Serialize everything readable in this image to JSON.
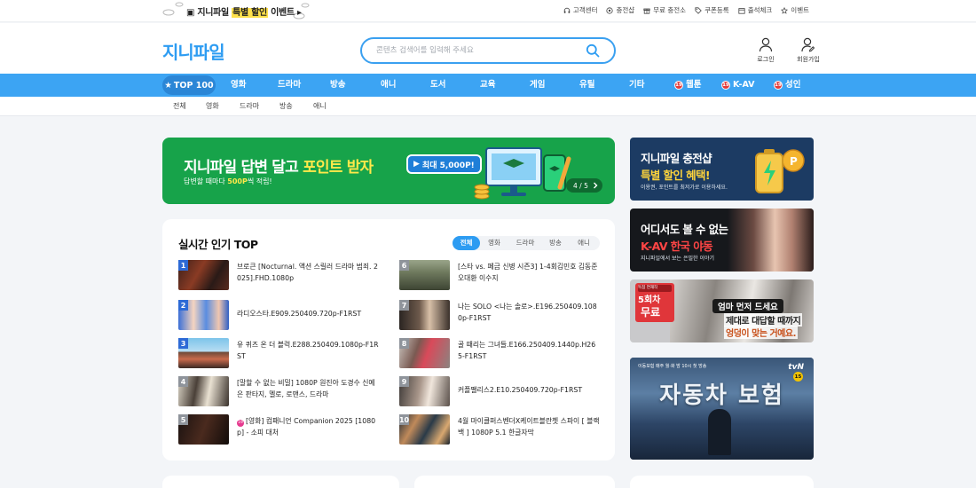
{
  "promo": {
    "before": "지니파일 ",
    "highlight": "특별 할인",
    "after": " 이벤트",
    "arrow": "▸"
  },
  "util_links": [
    {
      "label": "고객센터",
      "icon": "headset-icon"
    },
    {
      "label": "충전샵",
      "icon": "coin-icon"
    },
    {
      "label": "무료 충전소",
      "icon": "gift-icon"
    },
    {
      "label": "쿠폰등록",
      "icon": "tag-icon"
    },
    {
      "label": "출석체크",
      "icon": "calendar-icon"
    },
    {
      "label": "이벤트",
      "icon": "event-icon"
    }
  ],
  "header": {
    "logo": "지니파일",
    "search_placeholder": "콘텐츠 검색어를 입력해 주세요",
    "login": "로그인",
    "signup": "회원가입"
  },
  "nav": {
    "top100": "TOP 100",
    "items": [
      "영화",
      "드라마",
      "방송",
      "애니",
      "도서",
      "교육",
      "게임",
      "유틸",
      "기타"
    ],
    "adult_badge": "19",
    "adult_items": [
      "웹툰",
      "K-AV",
      "성인"
    ]
  },
  "subnav": [
    "전체",
    "영화",
    "드라마",
    "방송",
    "애니"
  ],
  "big_banner": {
    "title_before": "지니파일 답변 달고 ",
    "title_highlight": "포인트 받자",
    "sub_before": "답변할 때마다 ",
    "sub_highlight": "500P",
    "sub_after": "씩 적립!",
    "badge": "최대 5,000P!",
    "pager": "4 / 5"
  },
  "top_card": {
    "title": "실시간 인기 TOP",
    "tabs": [
      "전체",
      "영화",
      "드라마",
      "방송",
      "애니"
    ],
    "active_tab": 0,
    "items": [
      {
        "rank": "1",
        "title": "브로큰 [Nocturnal. 액션 스릴러 드라마 범죄. 2025].FHD.1080p"
      },
      {
        "rank": "2",
        "title": "라디오스타.E909.250409.720p-F1RST"
      },
      {
        "rank": "3",
        "title": "유 퀴즈 온 더 블럭.E288.250409.1080p-F1RST"
      },
      {
        "rank": "4",
        "title": "[말할 수 없는 비밀] 1080P 원진아 도경수 신예은 판타지, 멜로, 로맨스, 드라마"
      },
      {
        "rank": "5",
        "badge": "19",
        "title": "[영화] 컴패니언 Companion 2025 [1080p] - 소피 대처"
      },
      {
        "rank": "6",
        "title": "[스타 vs. 페금 신병 시즌3] 1-4회김민호 김동준 오대환 이수지"
      },
      {
        "rank": "7",
        "title": "나는 SOLO <나는 솔로>.E196.250409.1080p-F1RST"
      },
      {
        "rank": "8",
        "title": "골 때리는 그녀들.E166.250409.1440p.H265-F1RST"
      },
      {
        "rank": "9",
        "title": "커플팰리스2.E10.250409.720p-F1RST"
      },
      {
        "rank": "10",
        "title": "4월 마이클퍼스벤더X케이트블란쳇 스파이 [ 블랙 백 ] 1080P 5.1 한글자막"
      }
    ]
  },
  "right_banners": {
    "b1": {
      "line1": "지니파일 충전샵",
      "line2": "특별 할인 혜택!",
      "sub": "이용권, 포인트를 최저가로 이용하세요."
    },
    "b2": {
      "line1": "어디서도 볼 수 없는",
      "line2": "K-AV 한국 야동",
      "sub": "지니파일에서 보는 은밀한 이야기"
    },
    "b3": {
      "badge_top": "독점 연재작",
      "badge_main": "5회차",
      "badge_bottom": "무료",
      "line1": "엄마 먼저 드세요",
      "line2": "제대로 대답할 때까지",
      "line3": "엉덩이 맞는 거예요."
    },
    "b4": {
      "top": "이동보험 매주 월·화 밤 10시 첫 방송",
      "channel": "tvN",
      "age": "15",
      "title": "자동차 보험"
    }
  },
  "colors": {
    "accent": "#3ca4f3",
    "banner_green": "#17a34a",
    "highlight_yellow": "#ffe94a",
    "rank_blue": "#2d6ad6",
    "rank_gray": "#8f949b"
  }
}
